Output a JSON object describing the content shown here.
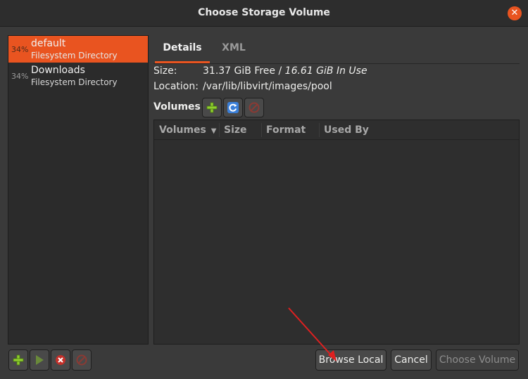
{
  "window": {
    "title": "Choose Storage Volume"
  },
  "pools": [
    {
      "percent": "34%",
      "name": "default",
      "type": "Filesystem Directory",
      "selected": true
    },
    {
      "percent": "34%",
      "name": "Downloads",
      "type": "Filesystem Directory",
      "selected": false
    }
  ],
  "tabs": [
    {
      "label": "Details"
    },
    {
      "label": "XML"
    }
  ],
  "details": {
    "size_label": "Size:",
    "size_free": "31.37 GiB Free / ",
    "size_in_use": "16.61 GiB In Use",
    "location_label": "Location:",
    "location_value": "/var/lib/libvirt/images/pool"
  },
  "volumes": {
    "label": "Volumes",
    "columns": [
      "Volumes",
      "Size",
      "Format",
      "Used By"
    ],
    "rows": []
  },
  "buttons": {
    "browse_local": "Browse Local",
    "cancel": "Cancel",
    "choose_volume": "Choose Volume"
  },
  "icons": {
    "add": "add-icon",
    "refresh": "refresh-icon",
    "delete": "delete-icon",
    "start": "play-icon",
    "stop": "stop-icon"
  },
  "colors": {
    "accent": "#e95420",
    "add": "#8fce2e",
    "refresh": "#3b7fd8",
    "stop": "#c4302a"
  }
}
